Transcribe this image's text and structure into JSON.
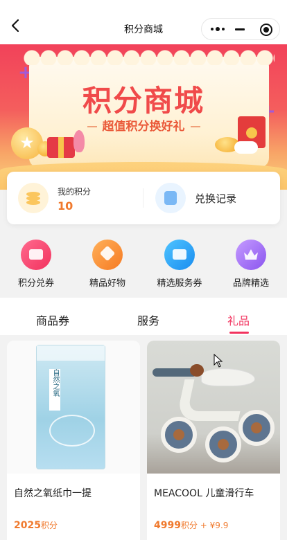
{
  "navbar": {
    "title": "积分商城",
    "back_icon": "chevron-left-icon",
    "more_icon": "more-dots-icon",
    "minimize_icon": "minimize-icon",
    "close_icon": "record-close-icon"
  },
  "banner": {
    "title": "积分商城",
    "subtitle": "超值积分换好礼"
  },
  "points": {
    "label": "我的积分",
    "value": "10",
    "records_label": "兑换记录"
  },
  "quick_entries": [
    {
      "label": "积分兑券",
      "icon": "ticket-icon",
      "color": "#f2325e"
    },
    {
      "label": "精品好物",
      "icon": "diamond-icon",
      "color": "#f67a22"
    },
    {
      "label": "精选服务券",
      "icon": "yen-coupon-icon",
      "color": "#1a8df0"
    },
    {
      "label": "品牌精选",
      "icon": "crown-icon",
      "color": "#8a55ef"
    }
  ],
  "tabs": [
    {
      "label": "商品券",
      "active": false
    },
    {
      "label": "服务",
      "active": false
    },
    {
      "label": "礼品",
      "active": true
    }
  ],
  "products": [
    {
      "name": "自然之氧纸巾一提",
      "price_points": "2025",
      "points_unit": "积分",
      "price_extra": "",
      "image": "tissue-pack-image",
      "image_text": "自然之氧"
    },
    {
      "name": "MEACOOL 儿童滑行车",
      "price_points": "4999",
      "points_unit": "积分",
      "price_extra": " + ¥9.9",
      "image": "kids-balance-bike-image"
    }
  ],
  "accent_color": "#f2325e",
  "price_color": "#f07a2e"
}
